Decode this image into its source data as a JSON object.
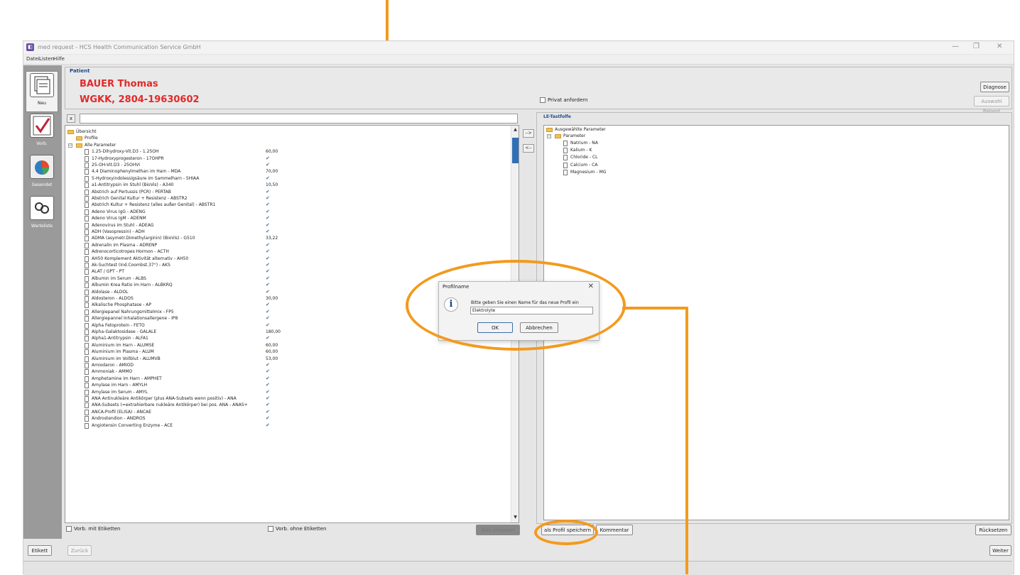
{
  "window": {
    "title": "med request - HCS Health Communication Service GmbH",
    "minimize": "—",
    "restore": "❐",
    "close": "✕"
  },
  "menu": [
    "Datei",
    "Listen",
    "Hilfe"
  ],
  "sidebar": [
    {
      "label": "Neu",
      "icon": "new-document-icon"
    },
    {
      "label": "Vorb.",
      "icon": "checklist-icon"
    },
    {
      "label": "Gesendet",
      "icon": "pie-chart-icon"
    },
    {
      "label": "Warteliste",
      "icon": "waitlist-icon"
    }
  ],
  "patient": {
    "group_label": "Patient",
    "name": "BAUER Thomas",
    "insurance": "WGKK, 2804-19630602",
    "privat_label": "Privat anfordern",
    "diagnose_btn": "Diagnose",
    "auswahl_btn": "Auswahl Patient"
  },
  "left_tree": {
    "clear_btn": "x",
    "root": "Übersicht",
    "profile": "Profile",
    "alle": "Alle Parameter",
    "items": [
      {
        "label": "1.25-Dihydroxy-Vit.D3 - 1.25OH",
        "value": "60,00"
      },
      {
        "label": "17-Hydroxyprogesteron - 17OHPR",
        "value": ""
      },
      {
        "label": "25-OH-Vit.D3 - 25OHVI",
        "value": ""
      },
      {
        "label": "4,4 Diaminophenylmethan im Harn - MDA",
        "value": "70,00"
      },
      {
        "label": "5-Hydroxyindolessigsäure im Sammelharn - 5HIAA",
        "value": ""
      },
      {
        "label": "a1-Antitrypsin im Stuhl (BioVis) - A340",
        "value": "10,50"
      },
      {
        "label": "Abstrich auf Pertussis (PCR) - PERTAB",
        "value": ""
      },
      {
        "label": "Abstrich Genital Kultur + Resistenz - ABSTR2",
        "value": ""
      },
      {
        "label": "Abstrich Kultur + Resistenz (alles außer Genital) - ABSTR1",
        "value": ""
      },
      {
        "label": "Adeno Virus IgG - ADENG",
        "value": ""
      },
      {
        "label": "Adeno Virus IgM - ADENM",
        "value": ""
      },
      {
        "label": "Adenovirus im Stuhl - ADEAG",
        "value": ""
      },
      {
        "label": "ADH (Vasopressin) - ADH",
        "value": ""
      },
      {
        "label": "ADMA (asymetr.Dimethylarginin) (BioVis) - G510",
        "value": "33,22"
      },
      {
        "label": "Adrenalin im Plasma - ADRENP",
        "value": ""
      },
      {
        "label": "Adrenocorticotropes Hormon - ACTH",
        "value": ""
      },
      {
        "label": "AH50 Komplement Aktivität alternativ - AH50",
        "value": ""
      },
      {
        "label": "Ak-Suchtest (Ind.Coombst.37°) - AKS",
        "value": ""
      },
      {
        "label": "ALAT / GPT - PT",
        "value": ""
      },
      {
        "label": "Albumin im Serum - ALBS",
        "value": ""
      },
      {
        "label": "Albumin Krea Ratio im Harn - ALBKRQ",
        "value": ""
      },
      {
        "label": "Aldolase - ALDOL",
        "value": ""
      },
      {
        "label": "Aldosteron - ALDOS",
        "value": "30,00"
      },
      {
        "label": "Alkalische Phosphatase - AP",
        "value": ""
      },
      {
        "label": "Allergiepanel Nahrungsmittelmix - FP5",
        "value": ""
      },
      {
        "label": "Allergiepannel Inhalationsallergene - IP8",
        "value": ""
      },
      {
        "label": "Alpha Fetoprotein - FETO",
        "value": ""
      },
      {
        "label": "Alpha-Galaktosidase - GALALE",
        "value": "180,00"
      },
      {
        "label": "Alpha1-Antitrypsin - ALFA1",
        "value": ""
      },
      {
        "label": "Aluminium im Harn - ALUMSE",
        "value": "60,00"
      },
      {
        "label": "Aluminium im Plasma - ALUM",
        "value": "60,00"
      },
      {
        "label": "Aluminium im Vollblut - ALUMVB",
        "value": "53,00"
      },
      {
        "label": "Amiodaron - AMIOD",
        "value": ""
      },
      {
        "label": "Ammoniak - AMMO",
        "value": ""
      },
      {
        "label": "Amphetamine im Harn - AMPHET",
        "value": ""
      },
      {
        "label": "Amylase im Harn - AMYLH",
        "value": ""
      },
      {
        "label": "Amylase im Serum - AMYL",
        "value": ""
      },
      {
        "label": "ANA Antinukleäre Antikörper (plus ANA-Subsets wenn positiv) - ANA",
        "value": ""
      },
      {
        "label": "ANA-Subsets (=extrahierbare nukleäre Antikörper) bei pos. ANA - ANAS+",
        "value": ""
      },
      {
        "label": "ANCA-Profil (ELISA) - ANCAE",
        "value": ""
      },
      {
        "label": "Androstendion - ANDROS",
        "value": ""
      },
      {
        "label": "Angiotensin Converting Enzyme - ACE",
        "value": ""
      }
    ]
  },
  "mid_buttons": {
    "add": "-->",
    "remove": "<--"
  },
  "right_tree": {
    "group_label": "LE-Tastfolfe",
    "root": "Ausgewählte Parameter",
    "parameter": "Parameter",
    "items": [
      "Natrium - NA",
      "Kalium - K",
      "Chloride - CL",
      "Calcium - CA",
      "Magnesium - MG"
    ]
  },
  "bottom": {
    "vorb_mit": "Vorb. mit Etiketten",
    "vorb_ohne": "Vorb. ohne Etiketten",
    "hidden_btn": "Neu erfassen",
    "als_profil": "als Profil speichern",
    "kommentar": "Kommentar",
    "ruecksetzen": "Rücksetzen",
    "etikett": "Etikett",
    "zurueck": "Zurück",
    "weiter": "Weiter"
  },
  "dialog": {
    "title": "Profilname",
    "close": "✕",
    "message": "Bitte geben Sie einen Name für das neue Profil ein",
    "input_value": "Elektrolyte",
    "ok": "OK",
    "cancel": "Abbrechen"
  },
  "colors": {
    "accent": "#f39a1e",
    "patient_red": "#e12a2a",
    "group_blue": "#1c4b8b"
  }
}
